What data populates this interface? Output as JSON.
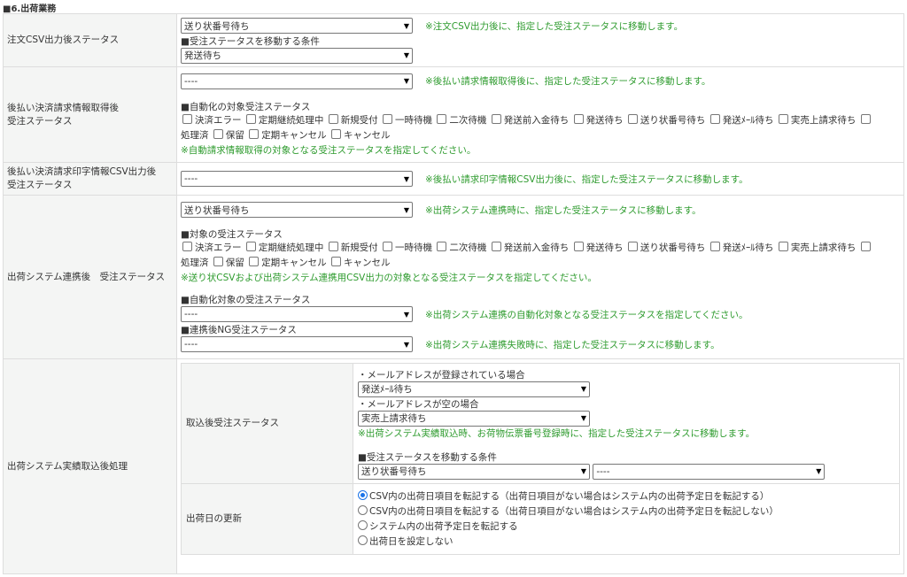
{
  "section_title": "■6.出荷業務",
  "statuses": [
    "決済エラー",
    "定期継続処理中",
    "新規受付",
    "一時待機",
    "二次待機",
    "発送前入金待ち",
    "発送待ち",
    "送り状番号待ち",
    "発送ﾒｰﾙ待ち",
    "実売上請求待ち",
    "処理済",
    "保留",
    "定期キャンセル",
    "キャンセル"
  ],
  "rows": {
    "r1": {
      "label": "注文CSV出力後ステータス",
      "select": "送り状番号待ち",
      "note": "※注文CSV出力後に、指定した受注ステータスに移動します。",
      "cond_label": "■受注ステータスを移動する条件",
      "cond_select": "発送待ち"
    },
    "r2": {
      "label1": "後払い決済請求情報取得後",
      "label2": "受注ステータス",
      "select": "----",
      "note": "※後払い請求情報取得後に、指定した受注ステータスに移動します。",
      "auto_label": "■自動化の対象受注ステータス",
      "auto_note": "※自動請求情報取得の対象となる受注ステータスを指定してください。"
    },
    "r3": {
      "label1": "後払い決済請求印字情報CSV出力後",
      "label2": "受注ステータス",
      "select": "----",
      "note": "※後払い請求印字情報CSV出力後に、指定した受注ステータスに移動します。"
    },
    "r4": {
      "label": "出荷システム連携後　受注ステータス",
      "select": "送り状番号待ち",
      "note": "※出荷システム連携時に、指定した受注ステータスに移動します。",
      "target_label": "■対象の受注ステータス",
      "target_note": "※送り状CSVおよび出荷システム連携用CSV出力の対象となる受注ステータスを指定してください。",
      "auto_label": "■自動化対象の受注ステータス",
      "auto_select": "----",
      "auto_note": "※出荷システム連携の自動化対象となる受注ステータスを指定してください。",
      "ng_label": "■連携後NG受注ステータス",
      "ng_select": "----",
      "ng_note": "※出荷システム連携失敗時に、指定した受注ステータスに移動します。"
    },
    "r5": {
      "label": "出荷システム実績取込後処理",
      "import": {
        "label": "取込後受注ステータス",
        "mail_label": "・メールアドレスが登録されている場合",
        "mail_select": "発送ﾒｰﾙ待ち",
        "empty_label": "・メールアドレスが空の場合",
        "empty_select": "実売上請求待ち",
        "note": "※出荷システム実績取込時、お荷物伝票番号登録時に、指定した受注ステータスに移動します。",
        "cond_label": "■受注ステータスを移動する条件",
        "cond_select1": "送り状番号待ち",
        "cond_select2": "----"
      },
      "ship_date": {
        "label": "出荷日の更新",
        "options": [
          "CSV内の出荷日項目を転記する（出荷日項目がない場合はシステム内の出荷予定日を転記する）",
          "CSV内の出荷日項目を転記する（出荷日項目がない場合はシステム内の出荷予定日を転記しない）",
          "システム内の出荷予定日を転記する",
          "出荷日を設定しない"
        ],
        "selected": 0
      }
    }
  }
}
